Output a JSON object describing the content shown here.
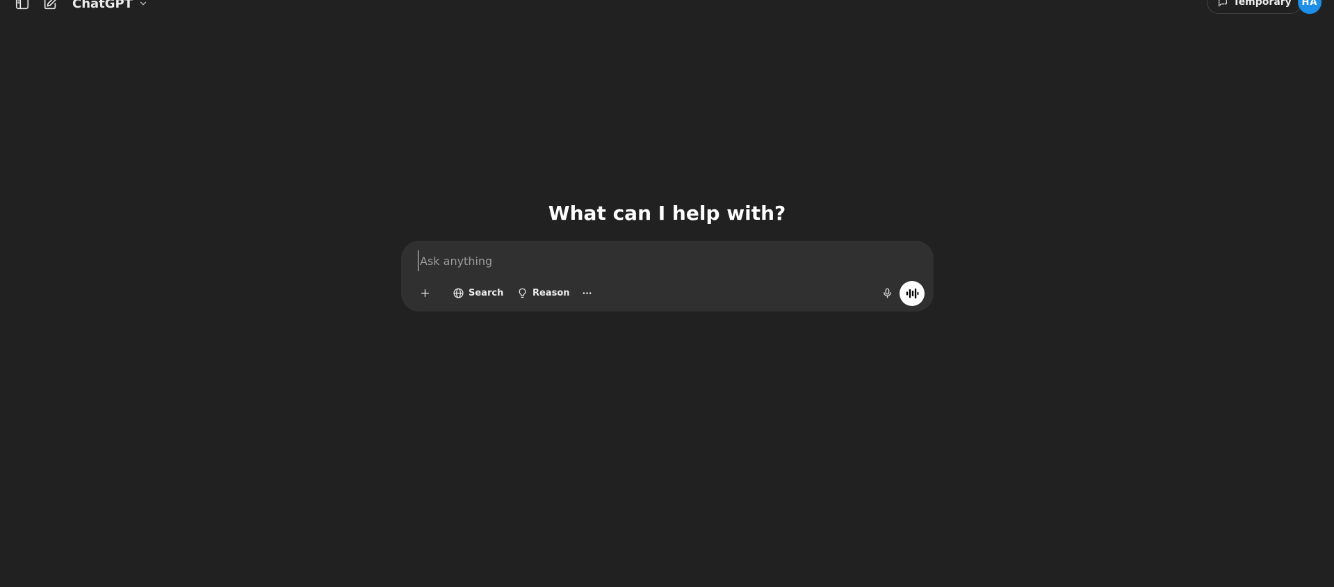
{
  "header": {
    "model_name": "ChatGPT",
    "temporary_label": "Temporary",
    "avatar_initials": "HA"
  },
  "main": {
    "headline": "What can I help with?"
  },
  "composer": {
    "placeholder": "Ask anything",
    "value": "",
    "tools": {
      "search_label": "Search",
      "reason_label": "Reason"
    }
  },
  "icons": {
    "sidebar": "sidebar-toggle-icon",
    "new_chat": "edit-icon",
    "model_dropdown": "chevron-down-icon",
    "temporary": "chat-bubble-dashed-icon",
    "plus": "plus-icon",
    "search": "globe-icon",
    "reason": "lightbulb-icon",
    "more": "more-horizontal-icon",
    "mic": "microphone-icon",
    "voice": "voice-waveform-icon"
  },
  "colors": {
    "background": "#212121",
    "composer": "#303030",
    "avatar": "#1d8fe8",
    "text": "#ececec"
  }
}
